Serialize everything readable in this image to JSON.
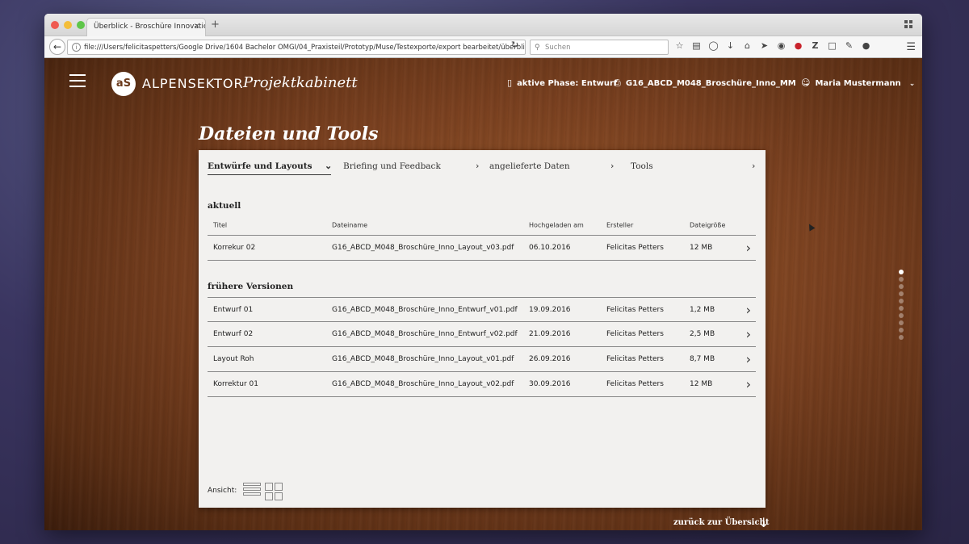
{
  "browser": {
    "tab_title": "Überblick - Broschüre Innovatio...",
    "tab_close": "×",
    "new_tab": "+",
    "url": "file:///Users/felicitaspetters/Google Drive/1604 Bachelor OMGI/04_Praxisteil/Prototyp/Muse/Testexporte/export bearbeitet/überblick",
    "search_placeholder": "Suchen",
    "icons": [
      "star-icon",
      "reader-icon",
      "pocket-icon",
      "download-icon",
      "home-icon",
      "send-icon",
      "globe-icon",
      "pinterest-icon",
      "zotero-icon",
      "page-icon",
      "pen-icon",
      "circle-icon"
    ]
  },
  "header": {
    "logo_mark": "aS",
    "brand": "ALPENSEKTOR",
    "brand_sub": "Projektkabinett",
    "phase": "aktive Phase: Entwurf",
    "project": "G16_ABCD_M048_Broschüre_Inno_MM",
    "user": "Maria Mustermann"
  },
  "page_title": "Dateien und Tools",
  "tabs": [
    {
      "label": "Entwürfe und Layouts"
    },
    {
      "label": "Briefing und Feedback"
    },
    {
      "label": "angelieferte Daten"
    },
    {
      "label": "Tools"
    }
  ],
  "sections": {
    "current": "aktuell",
    "previous": "frühere Versionen"
  },
  "columns": [
    "Titel",
    "Dateiname",
    "Hochgeladen am",
    "Ersteller",
    "Dateigröße"
  ],
  "current_rows": [
    [
      "Korrekur 02",
      "G16_ABCD_M048_Broschüre_Inno_Layout_v03.pdf",
      "06.10.2016",
      "Felicitas Petters",
      "12 MB"
    ]
  ],
  "previous_rows": [
    [
      "Entwurf 01",
      "G16_ABCD_M048_Broschüre_Inno_Entwurf_v01.pdf",
      "19.09.2016",
      "Felicitas Petters",
      "1,2 MB"
    ],
    [
      "Entwurf 02",
      "G16_ABCD_M048_Broschüre_Inno_Entwurf_v02.pdf",
      "21.09.2016",
      "Felicitas Petters",
      "2,5 MB"
    ],
    [
      "Layout Roh",
      "G16_ABCD_M048_Broschüre_Inno_Layout_v01.pdf",
      "26.09.2016",
      "Felicitas Petters",
      "8,7 MB"
    ],
    [
      "Korrektur 01",
      "G16_ABCD_M048_Broschüre_Inno_Layout_v02.pdf",
      "30.09.2016",
      "Felicitas Petters",
      "12 MB"
    ]
  ],
  "view_label": "Ansicht:",
  "back_link": "zurück zur Übersicht",
  "pager": {
    "count": 10,
    "active": 0
  },
  "colors": {
    "accent": "#ffffff",
    "wood": "#7b4120",
    "card": "#f2f1ef"
  }
}
